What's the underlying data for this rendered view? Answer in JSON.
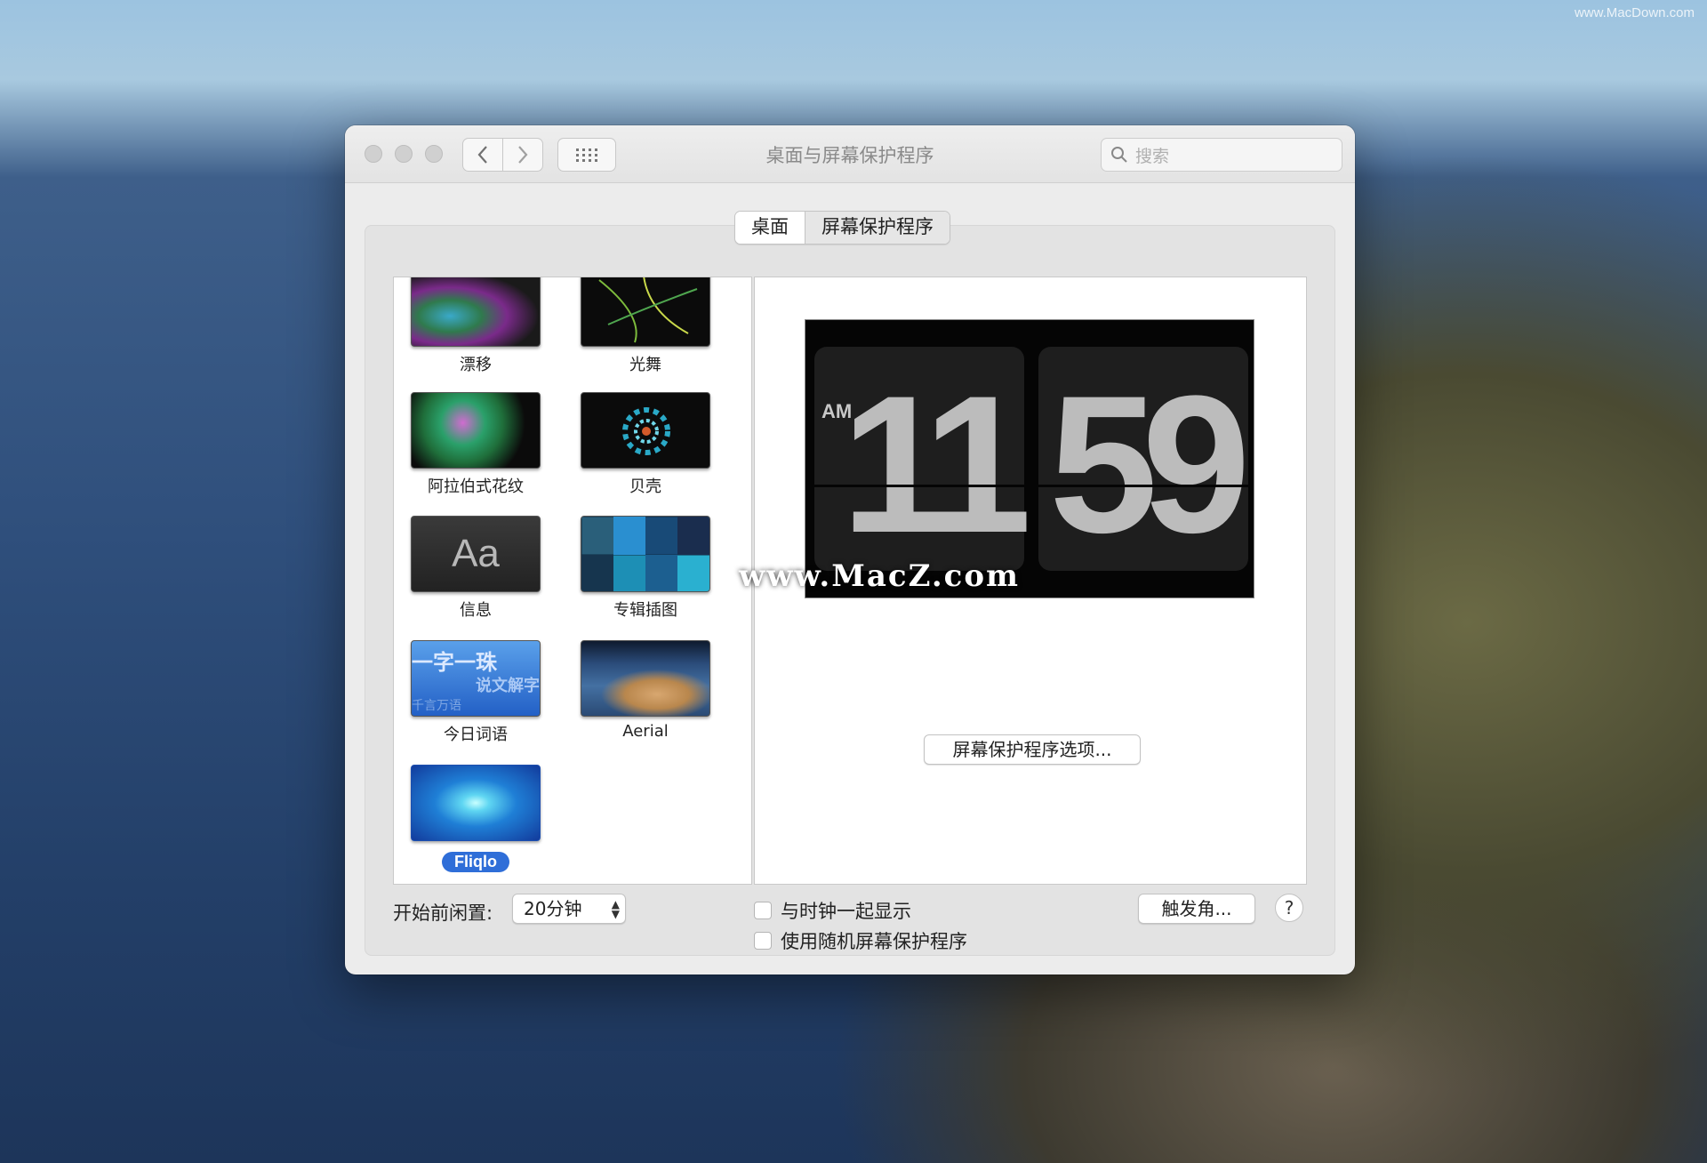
{
  "desktop": {
    "watermark": "www.MacDown.com"
  },
  "window": {
    "title": "桌面与屏幕保护程序",
    "search_placeholder": "搜索"
  },
  "tabs": [
    {
      "label": "桌面",
      "active": true
    },
    {
      "label": "屏幕保护程序",
      "active": false
    }
  ],
  "savers": [
    {
      "label": "漂移",
      "icon": "drift-thumbnail"
    },
    {
      "label": "光舞",
      "icon": "flurry-thumbnail"
    },
    {
      "label": "阿拉伯式花纹",
      "icon": "arabesque-thumbnail"
    },
    {
      "label": "贝壳",
      "icon": "shell-thumbnail"
    },
    {
      "label": "信息",
      "icon": "message-thumbnail",
      "thumb_text": "Aa"
    },
    {
      "label": "专辑插图",
      "icon": "album-artwork-thumbnail"
    },
    {
      "label": "今日词语",
      "icon": "word-of-the-day-thumbnail",
      "thumb_text_1": "一字一珠",
      "thumb_text_2": "说文解字",
      "thumb_text_3": "千言万语"
    },
    {
      "label": "Aerial",
      "icon": "aerial-thumbnail"
    },
    {
      "label": "Fliqlo",
      "icon": "fliqlo-thumbnail",
      "selected": true
    }
  ],
  "preview": {
    "ampm": "AM",
    "hour": "11",
    "minute": "59",
    "watermark": "www.MacZ.com",
    "options_button": "屏幕保护程序选项..."
  },
  "footer": {
    "idle_label": "开始前闲置:",
    "idle_value": "20分钟",
    "show_clock_label": "与时钟一起显示",
    "random_label": "使用随机屏幕保护程序",
    "hot_corners_button": "触发角...",
    "help_label": "?"
  },
  "colors": {
    "selection_accent": "#2f6ed8",
    "window_bg": "#ececec"
  }
}
